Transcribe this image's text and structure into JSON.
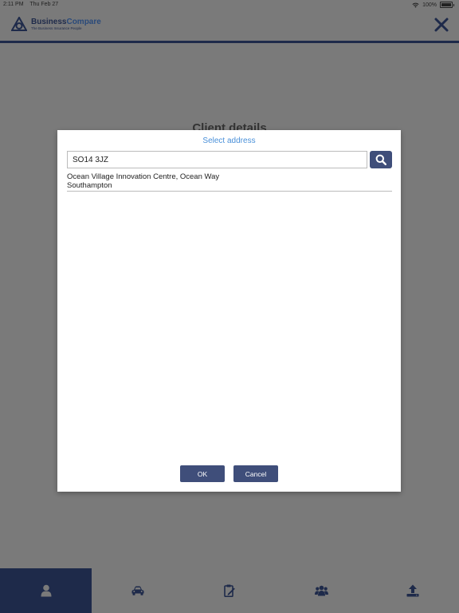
{
  "status_bar": {
    "time": "2:11 PM",
    "date": "Thu Feb 27",
    "battery": "100%"
  },
  "header": {
    "brand_part1": "Business",
    "brand_part2": "Compare",
    "tagline": "The Business Insurance People"
  },
  "page": {
    "title": "Client details"
  },
  "modal": {
    "title": "Select address",
    "search_value": "SO14 3JZ",
    "results": [
      {
        "line1": "Ocean Village Innovation Centre, Ocean Way",
        "line2": "Southampton"
      }
    ],
    "ok_label": "OK",
    "cancel_label": "Cancel"
  },
  "tabs": [
    {
      "icon": "person-icon",
      "active": true
    },
    {
      "icon": "car-icon",
      "active": false
    },
    {
      "icon": "clipboard-edit-icon",
      "active": false
    },
    {
      "icon": "group-icon",
      "active": false
    },
    {
      "icon": "upload-icon",
      "active": false
    }
  ],
  "colors": {
    "navy": "#1e2a4a",
    "button": "#3f4e7a",
    "accent": "#4a90d9",
    "overlay": "#7a7a7a"
  }
}
